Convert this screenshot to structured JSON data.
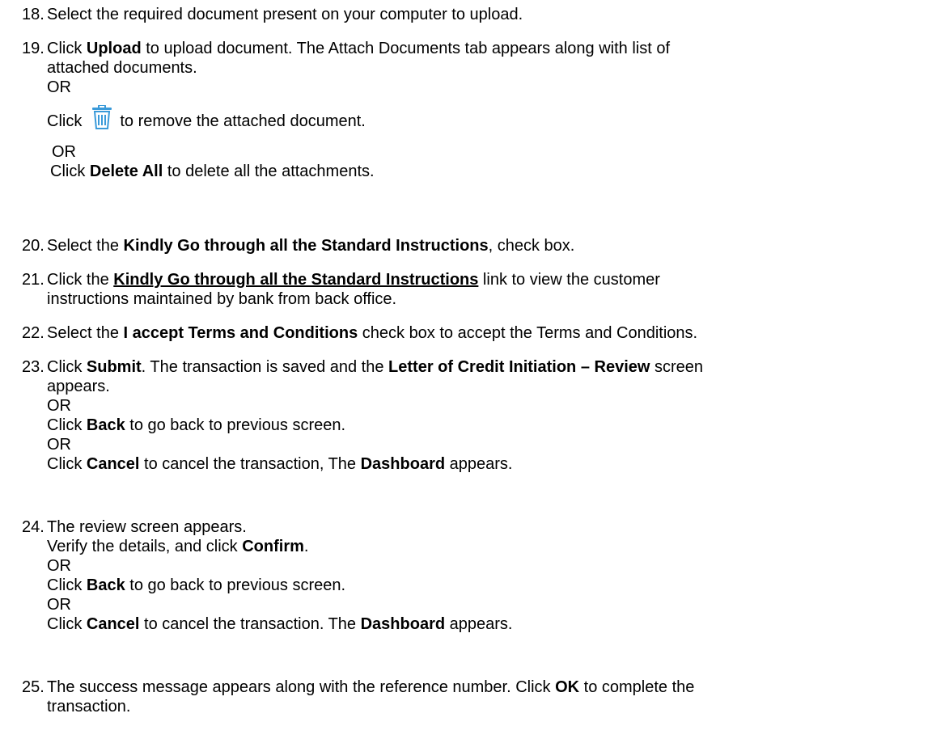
{
  "steps": [
    {
      "num": "18.",
      "text": "Select the required document present on your computer to upload."
    },
    {
      "num": "19.",
      "l1a": "Click ",
      "l1b": "Upload",
      "l1c": " to upload document. The Attach Documents tab appears along with list of",
      "l2": "attached documents.",
      "or1": "OR",
      "l3a": "Click",
      "l3icon": "trash-icon",
      "l3b": "to remove the attached document.",
      "or2": "OR",
      "l4a": "Click ",
      "l4b": "Delete All",
      "l4c": " to delete all the attachments."
    },
    {
      "num": "20.",
      "a": "Select the ",
      "b": "Kindly Go through all the Standard Instructions",
      "c": ", check box."
    },
    {
      "num": "21.",
      "a": "Click the ",
      "b": "Kindly Go through all the Standard Instructions",
      "c": " link to view the customer",
      "l2": "instructions maintained by bank from back office."
    },
    {
      "num": "22.",
      "a": "Select the ",
      "b": "I accept Terms and Conditions",
      "c": " check box to accept the Terms and Conditions."
    },
    {
      "num": "23.",
      "a": "Click ",
      "b": "Submit",
      "c": ". The transaction is saved and the ",
      "d": "Letter of Credit Initiation – Review",
      "e": " screen",
      "l2": "appears.",
      "or1": "OR",
      "l3a": "Click ",
      "l3b": "Back",
      "l3c": " to go back to previous screen.",
      "or2": "OR",
      "l4a": "Click ",
      "l4b": "Cancel",
      "l4c": " to cancel the transaction, The ",
      "l4d": "Dashboard",
      "l4e": " appears."
    },
    {
      "num": "24.",
      "l1": "The review screen appears.",
      "l2a": "Verify the details, and click ",
      "l2b": "Confirm",
      "l2c": ".",
      "or1": "OR",
      "l3a": "Click ",
      "l3b": "Back",
      "l3c": " to go back to previous screen.",
      "or2": "OR",
      "l4a": "Click ",
      "l4b": "Cancel",
      "l4c": " to cancel the transaction. The ",
      "l4d": "Dashboard",
      "l4e": " appears."
    },
    {
      "num": "25.",
      "a": "The success message appears along with the reference number. Click ",
      "b": "OK",
      "c": " to complete the",
      "l2": "transaction."
    }
  ],
  "colors": {
    "icon_blue": "#3a9ad9"
  }
}
